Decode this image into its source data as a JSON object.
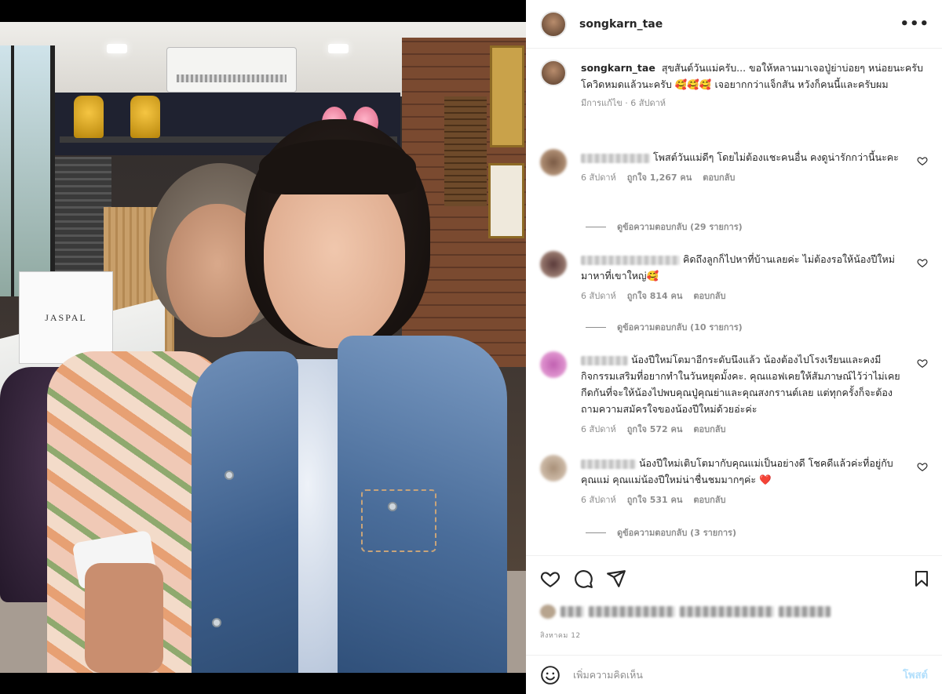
{
  "header": {
    "username": "songkarn_tae",
    "more_icon": "more-horizontal-icon"
  },
  "caption": {
    "username": "songkarn_tae",
    "text": "สุขสันต์วันแม่ครับ... ขอให้หลานมาเจอปู่ย่าบ่อยๆ หน่อยนะครับ โควิดหมดแล้วนะครับ 🥰🥰🥰 เจอยากกว่าแจ็กสัน หวังก็คนนี้และครับผม",
    "meta": "มีการแก้ไข · 6 สัปดาห์"
  },
  "comments": [
    {
      "text": "โพสต์วันแม่ดีๆ โดยไม่ต้องแชะคนอื่น คงดูน่ารักกว่านี้นะคะ",
      "time": "6 สัปดาห์",
      "likes": "ถูกใจ 1,267 คน",
      "reply": "ตอบกลับ",
      "view_replies": "ดูข้อความตอบกลับ (29 รายการ)"
    },
    {
      "text": "คิดถึงลูกก็ไปหาที่บ้านเลยค่ะ ไม่ต้องรอให้น้องปีใหม่มาหาที่เขาใหญ่🥰",
      "time": "6 สัปดาห์",
      "likes": "ถูกใจ 814 คน",
      "reply": "ตอบกลับ",
      "view_replies": "ดูข้อความตอบกลับ (10 รายการ)"
    },
    {
      "text": "น้องปีใหม่โตมาอีกระดับนึงแล้ว น้องต้องไปโรงเรียนและคงมีกิจกรรมเสริมที่อยากทำในวันหยุดมั้งคะ. คุณแอฟเคยให้สัมภาษณ์ไว้ว่าไม่เคยกีดกันที่จะให้น้องไปพบคุณปู่คุณย่าและคุณสงกรานต์เลย แต่ทุกครั้งก็จะต้องถามความสมัครใจของน้องปีใหม่ด้วยอ่ะค่ะ",
      "time": "6 สัปดาห์",
      "likes": "ถูกใจ 572 คน",
      "reply": "ตอบกลับ"
    },
    {
      "text": "น้องปีใหม่เติบโตมากับคุณแม่เป็นอย่างดี โชคดีแล้วค่ะที่อยู่กับคุณแม่ คุณแม่น้องปีใหม่น่าชื่นชมมากๆค่ะ ❤️",
      "time": "6 สัปดาห์",
      "likes": "ถูกใจ 531 คน",
      "reply": "ตอบกลับ",
      "view_replies": "ดูข้อความตอบกลับ (3 รายการ)"
    }
  ],
  "actions": {
    "like_icon": "heart-icon",
    "comment_icon": "comment-icon",
    "share_icon": "send-icon",
    "save_icon": "bookmark-icon",
    "date": "สิงหาคม 12"
  },
  "add_comment": {
    "placeholder": "เพิ่มความคิดเห็น",
    "post_label": "โพสต์",
    "emoji_icon": "smile-icon"
  },
  "photo": {
    "bag_text": "JASPAL"
  },
  "colors": {
    "accent": "#0095f6",
    "post_disabled": "#b2dffc",
    "muted": "#8e8e8e",
    "liked": "#ed4956"
  }
}
